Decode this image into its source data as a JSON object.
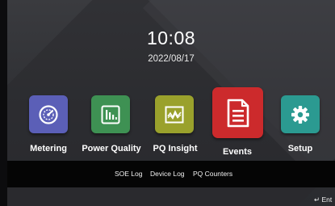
{
  "clock": {
    "time": "10:08",
    "date": "2022/08/17"
  },
  "apps": [
    {
      "label": "Metering",
      "icon": "gauge-icon",
      "color": "#5b5fb7"
    },
    {
      "label": "Power Quality",
      "icon": "bar-chart-icon",
      "color": "#3e9153"
    },
    {
      "label": "PQ Insight",
      "icon": "waveform-icon",
      "color": "#9aa12c"
    },
    {
      "label": "Events",
      "icon": "document-icon",
      "color": "#cc2a2c"
    },
    {
      "label": "Setup",
      "icon": "gear-icon",
      "color": "#2b9a91"
    }
  ],
  "tabs": [
    "SOE Log",
    "Device Log",
    "PQ Counters"
  ],
  "footer": {
    "enter_label": "↵ Ent"
  }
}
